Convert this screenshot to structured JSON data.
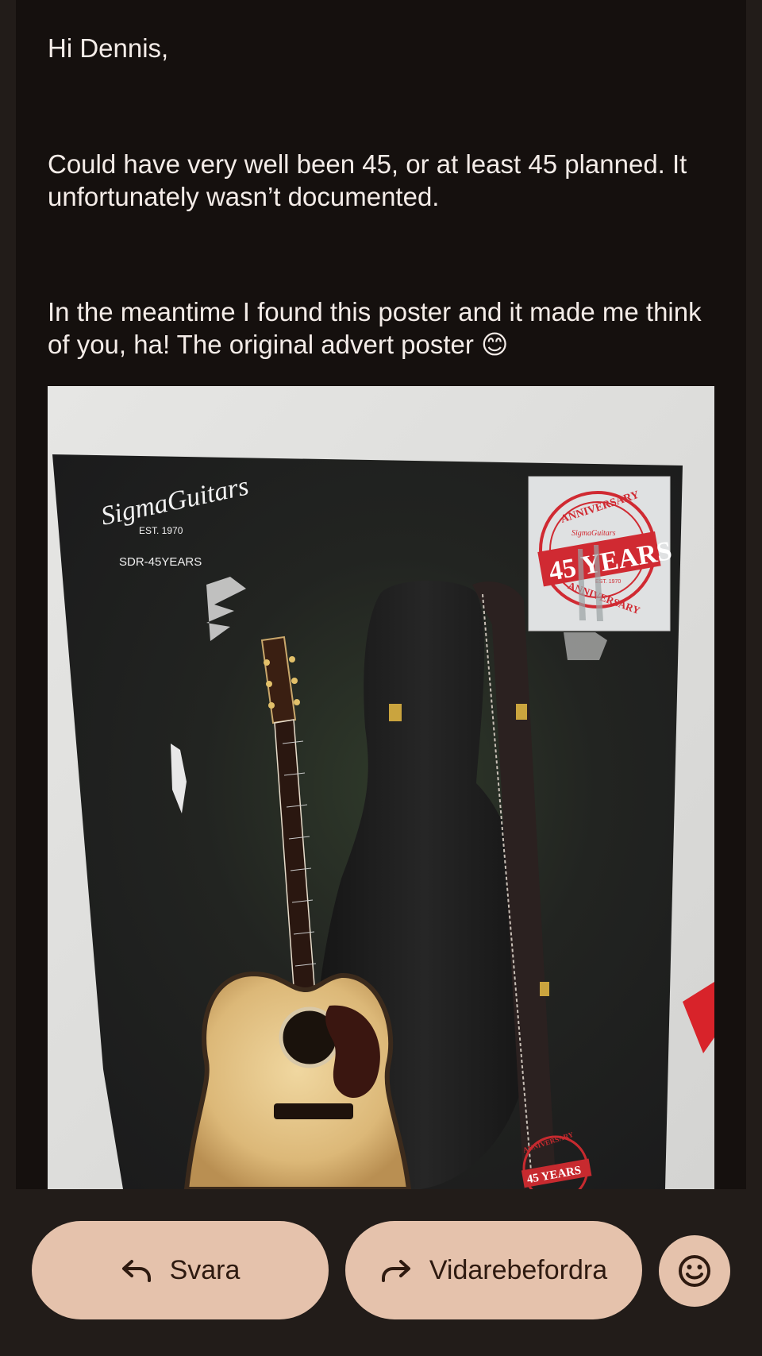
{
  "email": {
    "greeting": "Hi Dennis,",
    "paragraph1": "Could have very well been 45, or at least 45 planned. It unfortunately wasn’t documented.",
    "paragraph2": "In the meantime I found this poster and it made me think of you, ha! The original advert poster 😊"
  },
  "poster": {
    "brand": "SigmaGuitars",
    "est": "EST. 1970",
    "model": "SDR-45YEARS",
    "badge_top": "ANNIVERSARY",
    "badge_inner": "SigmaGuitars",
    "badge_main": "45 YEARS",
    "badge_small": "EST. 1970",
    "badge_bottom": "ANNIVERSARY",
    "stamp_text": "45 YEARS",
    "stamp_ring": "ANNIVERSARY"
  },
  "actions": {
    "reply_label": "Svara",
    "forward_label": "Vidarebefordra",
    "reply_icon": "reply-arrow-icon",
    "forward_icon": "forward-arrow-icon",
    "emoji_icon": "smiley-face-icon"
  },
  "colors": {
    "background": "#221c19",
    "card": "#15100e",
    "text": "#f4ece8",
    "button": "#e5c2ac",
    "button_text": "#2e1a10",
    "badge_red": "#d02a32"
  }
}
